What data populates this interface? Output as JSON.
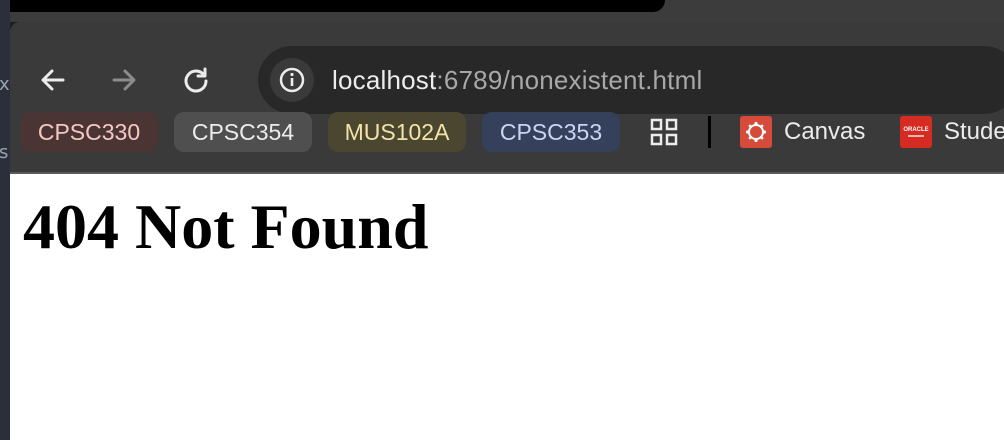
{
  "browser": {
    "nav": {
      "back_icon": "arrow-left-icon",
      "forward_icon": "arrow-right-icon",
      "reload_icon": "reload-icon"
    },
    "address_bar": {
      "info_icon": "info-icon",
      "url_host": "localhost",
      "url_rest": ":6789/nonexistent.html"
    },
    "bookmarks": [
      {
        "label": "CPSC330",
        "bg": "#4a3434",
        "fg": "#f4c9c4"
      },
      {
        "label": "CPSC354",
        "bg": "#4f4f4f",
        "fg": "#ececec"
      },
      {
        "label": "MUS102A",
        "bg": "#4b4630",
        "fg": "#f3e3a8"
      },
      {
        "label": "CPSC353",
        "bg": "#35405a",
        "fg": "#c8d6f6"
      }
    ],
    "apps_icon": "apps-grid-icon",
    "links": [
      {
        "label": "Canvas",
        "icon": "canvas-logo-icon",
        "color": "#d64a39"
      },
      {
        "label": "Stude",
        "icon": "oracle-peoplesoft-logo-icon",
        "color": "#d62b22",
        "logo_text": "ORACLE"
      }
    ]
  },
  "page": {
    "heading": "404 Not Found"
  },
  "desktop": {
    "edge_glyphs": [
      "x",
      "s"
    ]
  }
}
